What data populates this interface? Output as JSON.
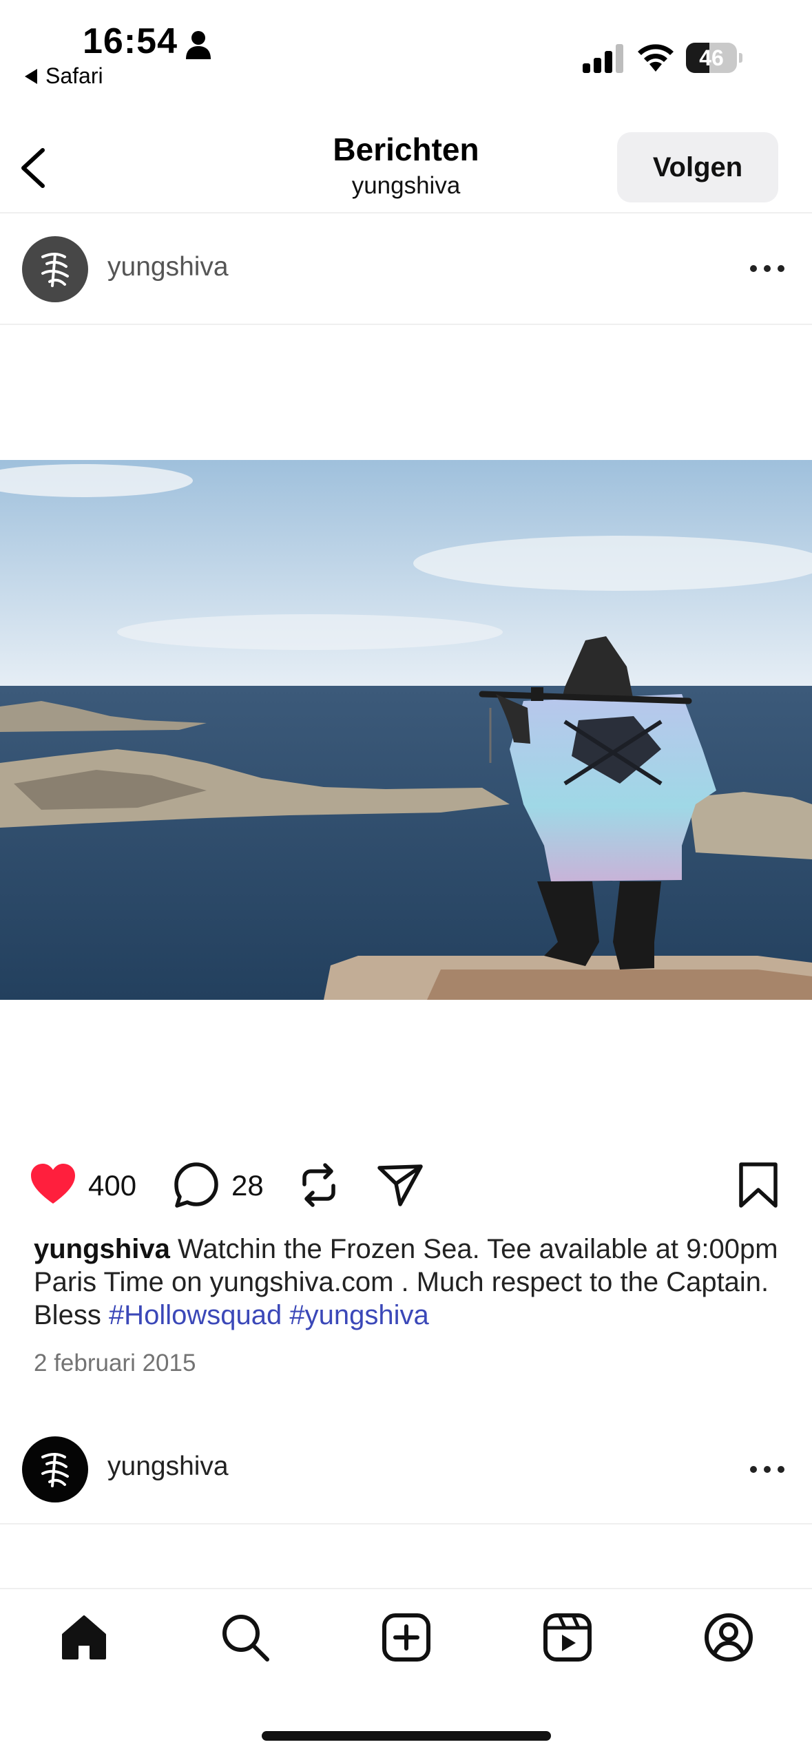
{
  "status_bar": {
    "time": "16:54",
    "back_app": "Safari",
    "battery": "46",
    "battery_level": 0.46,
    "icons": [
      "person-icon",
      "cellular-signal-icon",
      "wifi-icon",
      "battery-icon"
    ]
  },
  "header": {
    "title": "Berichten",
    "subtitle": "yungshiva",
    "follow_label": "Volgen"
  },
  "post": {
    "username": "yungshiva",
    "likes": "400",
    "comments": "28",
    "caption_user": "yungshiva",
    "caption_text": " Watchin the Frozen Sea. Tee available at 9:00pm Paris Time on yungshiva.com . Much respect to the Captain. Bless ",
    "hashtag_1": "#Hollowsquad",
    "hashtag_2": "#yungshiva",
    "date": "2 februari 2015",
    "liked": true
  },
  "next_post": {
    "username": "yungshiva"
  },
  "bottom_nav": {
    "items": [
      "home",
      "search",
      "create",
      "reels",
      "profile"
    ]
  },
  "colors": {
    "like": "#ff1f3d",
    "hashtag": "#3b48b8",
    "follow_bg": "#efeff1"
  }
}
